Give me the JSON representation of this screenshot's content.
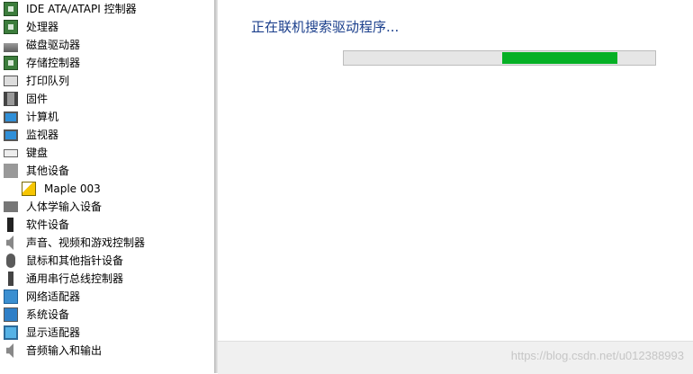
{
  "tree": {
    "items": [
      {
        "label": "IDE ATA/ATAPI 控制器",
        "icon": "ide-controller-icon",
        "indent": 0
      },
      {
        "label": "处理器",
        "icon": "processor-icon",
        "indent": 0
      },
      {
        "label": "磁盘驱动器",
        "icon": "disk-drive-icon",
        "indent": 0
      },
      {
        "label": "存储控制器",
        "icon": "storage-controller-icon",
        "indent": 0
      },
      {
        "label": "打印队列",
        "icon": "printer-icon",
        "indent": 0
      },
      {
        "label": "固件",
        "icon": "firmware-icon",
        "indent": 0
      },
      {
        "label": "计算机",
        "icon": "computer-icon",
        "indent": 0
      },
      {
        "label": "监视器",
        "icon": "monitor-icon",
        "indent": 0
      },
      {
        "label": "键盘",
        "icon": "keyboard-icon",
        "indent": 0
      },
      {
        "label": "其他设备",
        "icon": "other-devices-icon",
        "indent": 0
      },
      {
        "label": "Maple 003",
        "icon": "warning-device-icon",
        "indent": 1
      },
      {
        "label": "人体学输入设备",
        "icon": "hid-icon",
        "indent": 0
      },
      {
        "label": "软件设备",
        "icon": "software-device-icon",
        "indent": 0
      },
      {
        "label": "声音、视频和游戏控制器",
        "icon": "sound-icon",
        "indent": 0
      },
      {
        "label": "鼠标和其他指针设备",
        "icon": "mouse-icon",
        "indent": 0
      },
      {
        "label": "通用串行总线控制器",
        "icon": "usb-icon",
        "indent": 0
      },
      {
        "label": "网络适配器",
        "icon": "network-adapter-icon",
        "indent": 0
      },
      {
        "label": "系统设备",
        "icon": "system-device-icon",
        "indent": 0
      },
      {
        "label": "显示适配器",
        "icon": "display-adapter-icon",
        "indent": 0
      },
      {
        "label": "音频输入和输出",
        "icon": "audio-io-icon",
        "indent": 0
      }
    ]
  },
  "dialog": {
    "status_text": "正在联机搜索驱动程序...",
    "progress": {
      "fill_start": 0.51,
      "fill_end": 0.88,
      "fill_color": "#06b025"
    }
  },
  "footer": {
    "watermark": "https://blog.csdn.net/u012388993"
  }
}
